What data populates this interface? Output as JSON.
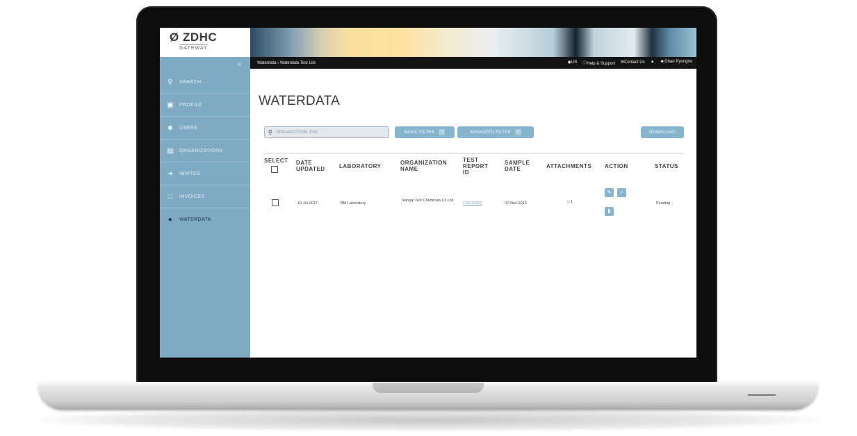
{
  "app": {
    "logo": "ZDHC",
    "logo_sub": "GATEWAY"
  },
  "sidebar": {
    "collapse_icon": "«",
    "items": [
      {
        "label": "SEARCH",
        "icon": "search-icon"
      },
      {
        "label": "PROFILE",
        "icon": "profile-icon"
      },
      {
        "label": "USERS",
        "icon": "user-icon"
      },
      {
        "label": "ORGANIZATIONS",
        "icon": "organization-icon"
      },
      {
        "label": "INVITES",
        "icon": "invite-icon"
      },
      {
        "label": "INVOICES",
        "icon": "invoice-icon"
      },
      {
        "label": "WATERDATA",
        "icon": "water-drop-icon"
      }
    ]
  },
  "topbar": {
    "breadcrumb": "Waterdata › Waterdata Test List",
    "language": "US",
    "help": "Help & Support",
    "contact": "Contact Us",
    "user": "Ghan Pyongho"
  },
  "page": {
    "title": "WATERDATA",
    "search_placeholder": "ORGANIZATION, ENC",
    "basic_filter": "BASIC FILTER",
    "advanced_filter": "ADVANCED FILTER",
    "download": "DOWNLOAD"
  },
  "table": {
    "headers": {
      "select": "SELECT",
      "date_updated": "DATE UPDATED",
      "laboratory": "LABORATORY",
      "organization_name": "ORGANIZATION NAME",
      "test_report_id": "TEST REPORT ID",
      "sample_date": "SAMPLE DATE",
      "attachments": "ATTACHMENTS",
      "action": "ACTION",
      "status": "STATUS"
    },
    "rows": [
      {
        "date_updated": "19-Jul-2017",
        "laboratory": "BM Laboratory",
        "organization_name": "Nangal Test Chemicals Co Ltd.",
        "test_report_id": "T10124503",
        "sample_date": "07-Nov-2016",
        "attachments": "1",
        "status": "Pending"
      }
    ]
  },
  "colors": {
    "sidebar": "#7faac4",
    "accent": "#86b6cf",
    "topbar": "#141414"
  }
}
